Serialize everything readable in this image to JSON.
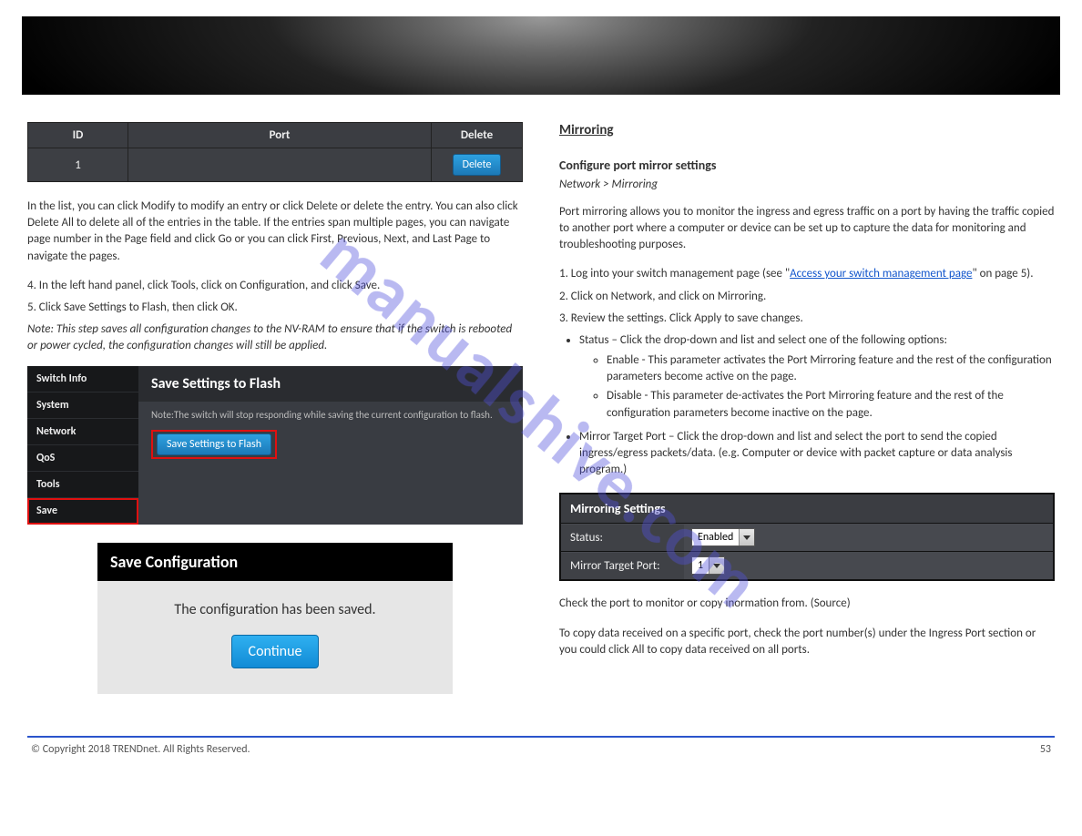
{
  "watermark": "manualshive.com",
  "left": {
    "table": {
      "h1": "ID",
      "h2": "Port",
      "h3": "Delete",
      "row_id": "1",
      "delete_btn": "Delete"
    },
    "p_mod": "In the list, you can click Modify to modify an entry or click Delete or delete the entry. You can also click Delete All to delete all of the entries in the table. If the entries span multiple pages, you can navigate page number in the Page field and click Go or you can click First, Previous, Next, and Last Page to navigate the pages.",
    "step4": "4. In the left hand panel, click Tools, click on Configuration, and click Save.",
    "step5": "5. Click Save Settings to Flash, then click OK.",
    "note": "Note: This step saves all configuration changes to the NV-RAM to ensure that if the switch is rebooted or power cycled, the configuration changes will still be applied.",
    "flash": {
      "sidebar": [
        "Switch Info",
        "System",
        "Network",
        "QoS",
        "Tools",
        "Save"
      ],
      "title": "Save Settings to Flash",
      "note": "Note:The switch will stop responding while saving the current configuration to flash.",
      "btn": "Save Settings to Flash"
    },
    "confirm": {
      "title": "Save Configuration",
      "msg": "The configuration has been saved.",
      "btn": "Continue"
    }
  },
  "right": {
    "heading": "Mirroring",
    "sub": "Configure port mirror settings",
    "path": "Network > Mirroring",
    "desc": "Port mirroring allows you to monitor the ingress and egress traffic on a port by having the traffic copied to another port where a computer or device can be set up to capture the data for monitoring and troubleshooting purposes.",
    "step1_a": "1. Log into your switch management page (see \"",
    "step1_link": "Access your switch management page",
    "step1_b": "\" on page 5).",
    "step2": "2. Click on Network, and click on Mirroring.",
    "step3": "3. Review the settings. Click Apply to save changes.",
    "bul1_a": "Status – Click the drop-down and list and select one of the following options:",
    "bul1_en": "Enable - This parameter activates the Port Mirroring feature and the rest of the configuration parameters become active on the page.",
    "bul1_dis": "Disable - This parameter de-activates the Port Mirroring feature and the rest of the configuration parameters become inactive on the page.",
    "bul2": "Mirror Target Port – Click the drop-down and list and select the port to send the copied ingress/egress packets/data. (e.g. Computer or device with packet capture or data analysis program.)",
    "mirror": {
      "title": "Mirroring Settings",
      "status_label": "Status:",
      "status_val": "Enabled",
      "target_label": "Mirror Target Port:",
      "target_val": "1"
    },
    "p_after": "Check the port to monitor or copy inormation from. (Source)",
    "p_after2": "To copy data received on a specific port, check the port number(s) under the Ingress Port section or you could click All to copy data received on all ports."
  },
  "footer": {
    "left": "© Copyright 2018 TRENDnet. All Rights Reserved.",
    "right": "53"
  }
}
